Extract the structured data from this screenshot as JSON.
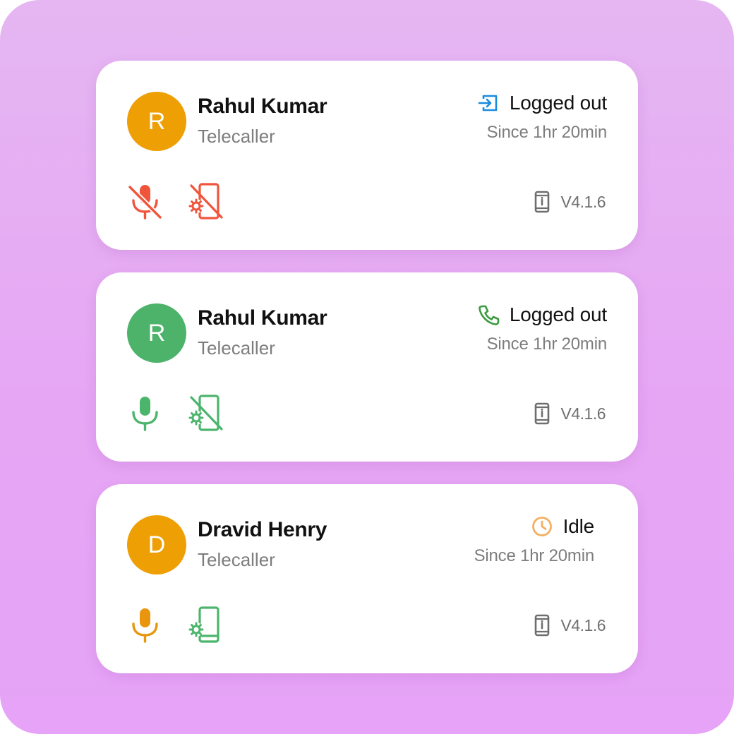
{
  "colors": {
    "avatar_orange": "#ee9f04",
    "avatar_green": "#4db36a",
    "alert_red": "#f0553c",
    "ok_green": "#4cb56c",
    "mic_orange": "#e9950d",
    "logout_blue": "#1a8ce0",
    "phone_green": "#3a9a3e",
    "idle_orange": "#f4b060",
    "muted_gray": "#6e6e6e"
  },
  "cards": [
    {
      "initial": "R",
      "name": "Rahul Kumar",
      "role": "Telecaller",
      "status_icon": "logout-icon",
      "status": "Logged out",
      "since": "Since 1hr 20min",
      "mic": "mic-off-icon",
      "device": "device-settings-off-icon",
      "version": "V4.1.6"
    },
    {
      "initial": "R",
      "name": "Rahul Kumar",
      "role": "Telecaller",
      "status_icon": "phone-icon",
      "status": "Logged out",
      "since": "Since 1hr 20min",
      "mic": "mic-icon",
      "device": "device-settings-off-icon",
      "version": "V4.1.6"
    },
    {
      "initial": "D",
      "name": "Dravid Henry",
      "role": "Telecaller",
      "status_icon": "clock-icon",
      "status": "Idle",
      "since": "Since 1hr 20min",
      "mic": "mic-icon",
      "device": "device-settings-icon",
      "version": "V4.1.6"
    }
  ]
}
